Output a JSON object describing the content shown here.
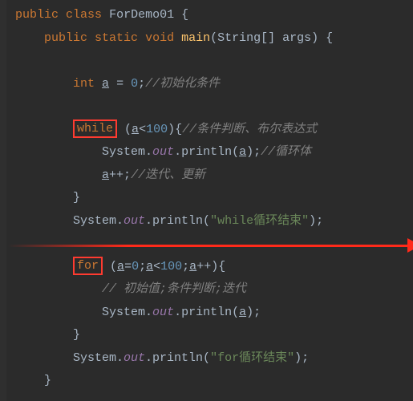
{
  "code": {
    "l1_kw1": "public",
    "l1_kw2": "class",
    "l1_cls": "ForDemo01",
    "l1_brace": " {",
    "l2_kw1": "public",
    "l2_kw2": "static",
    "l2_kw3": "void",
    "l2_method": "main",
    "l2_sig": "(String[] args) {",
    "l4_type": "int",
    "l4_var": "a",
    "l4_eq": " = ",
    "l4_val": "0",
    "l4_semi": ";",
    "l4_comment": "//初始化条件",
    "l6_kw": "while",
    "l6_open": " (",
    "l6_var": "a",
    "l6_cond": "<",
    "l6_num": "100",
    "l6_close": "){",
    "l6_comment": "//条件判断、布尔表达式",
    "l7_sys": "System.",
    "l7_out": "out",
    "l7_println": ".println(",
    "l7_var": "a",
    "l7_end": ");",
    "l7_comment": "//循环体",
    "l8_var": "a",
    "l8_op": "++;",
    "l8_comment": "//迭代、更新",
    "l9_brace": "}",
    "l10_sys": "System.",
    "l10_out": "out",
    "l10_println": ".println(",
    "l10_str": "\"while循环结束\"",
    "l10_end": ");",
    "l12_kw": "for",
    "l12_open": " (",
    "l12_var1": "a",
    "l12_eq": "=",
    "l12_n0": "0",
    "l12_s1": ";",
    "l12_var2": "a",
    "l12_lt": "<",
    "l12_n100": "100",
    "l12_s2": ";",
    "l12_var3": "a",
    "l12_inc": "++){",
    "l13_comment": "// 初始值;条件判断;迭代",
    "l14_sys": "System.",
    "l14_out": "out",
    "l14_println": ".println(",
    "l14_var": "a",
    "l14_end": ");",
    "l15_brace": "}",
    "l16_sys": "System.",
    "l16_out": "out",
    "l16_println": ".println(",
    "l16_str": "\"for循环结束\"",
    "l16_end": ");",
    "l17_brace": "}"
  }
}
